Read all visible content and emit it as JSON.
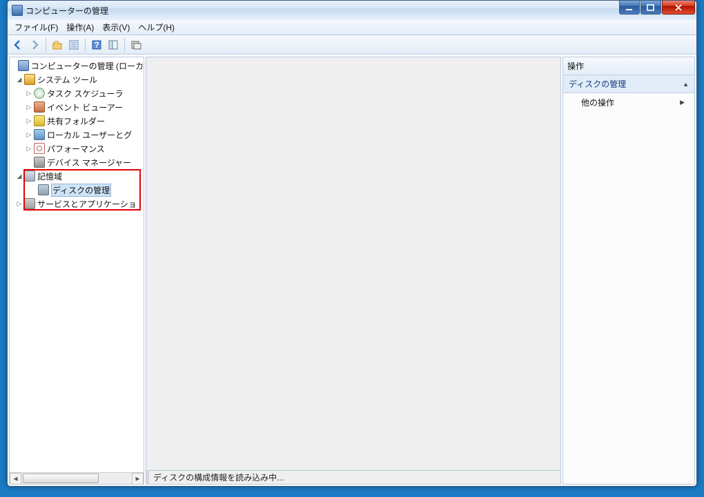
{
  "window": {
    "title": "コンピューターの管理"
  },
  "menu": {
    "file": "ファイル(F)",
    "action": "操作(A)",
    "view": "表示(V)",
    "help": "ヘルプ(H)"
  },
  "tree": {
    "root": "コンピューターの管理 (ローカ",
    "systools": "システム ツール",
    "task": "タスク スケジューラ",
    "event": "イベント ビューアー",
    "share": "共有フォルダー",
    "users": "ローカル ユーザーとグ",
    "perf": "パフォーマンス",
    "device": "デバイス マネージャー",
    "storage": "記憶域",
    "disk": "ディスクの管理",
    "services": "サービスとアプリケーショ"
  },
  "status": "ディスクの構成情報を読み込み中...",
  "actions": {
    "header": "操作",
    "section": "ディスクの管理",
    "more": "他の操作"
  }
}
